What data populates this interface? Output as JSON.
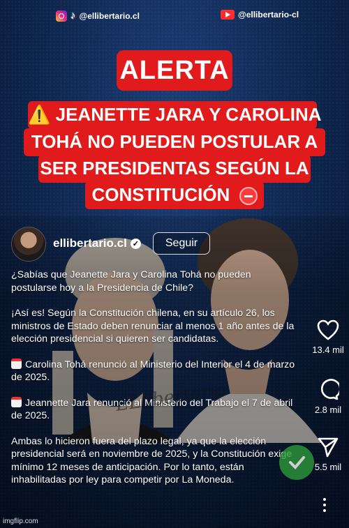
{
  "header": {
    "instagram_handle": "@ellibertario.cl",
    "youtube_handle": "@ellibertario-cl"
  },
  "alert": {
    "label": "ALERTA",
    "warning_icon": "⚠️",
    "headline_lines": [
      "JEANETTE JARA Y CAROLINA",
      "TOHÁ NO PUEDEN POSTULAR A",
      "SER PRESIDENTAS SEGÚN LA",
      "CONSTITUCIÓN"
    ]
  },
  "post": {
    "username": "ellibertario.cl",
    "follow_label": "Seguir",
    "watermark": "ELlibertario",
    "caption": {
      "p1": "¿Sabías que Jeanette Jara y Carolina Tohá no pueden postularse hoy a la Presidencia de Chile?",
      "p2": "¡Así es! Según la Constitución chilena, en su artículo 26, los ministros de Estado deben renunciar al menos 1 año antes de la elección presidencial si quieren ser candidatas.",
      "p3": "Carolina Tohá renunció al Ministerio del Interior el 4 de marzo de 2025.",
      "p4": "Jeannette Jara renunció al Ministerio del Trabajo el 7 de abril de 2025.",
      "p5": "Ambas lo hicieron fuera del plazo legal, ya que la elección presidencial será en noviembre de 2025, y la Constitución exige mínimo 12 meses de anticipación. Por lo tanto, están inhabilitadas por ley para competir por La Moneda."
    }
  },
  "actions": {
    "likes": "13.4 mil",
    "comments": "2.8 mil",
    "shares": "5.5 mil"
  },
  "footer": {
    "watermark": "imgflip.com"
  },
  "colors": {
    "alert_red": "#e11b1b",
    "background_blue": "#102a55",
    "verified_green": "#2d9a3a"
  }
}
